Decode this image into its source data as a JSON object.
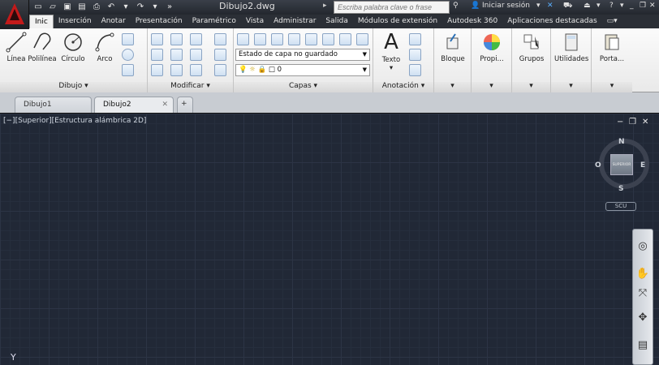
{
  "window": {
    "title": "Dibujo2.dwg",
    "search_placeholder": "Escriba palabra clave o frase",
    "signin": "Iniciar sesión"
  },
  "menu": {
    "tabs": [
      "Inic",
      "Inserción",
      "Anotar",
      "Presentación",
      "Paramétrico",
      "Vista",
      "Administrar",
      "Salida",
      "Módulos de extensión",
      "Autodesk 360",
      "Aplicaciones destacadas"
    ]
  },
  "ribbon": {
    "dibujo": {
      "label": "Dibujo",
      "tools": [
        "Línea",
        "Polilínea",
        "Círculo",
        "Arco"
      ]
    },
    "modificar": {
      "label": "Modificar"
    },
    "capas": {
      "label": "Capas",
      "layer_state": "Estado de capa no guardado",
      "current_layer": "0"
    },
    "anotacion": {
      "label": "Anotación",
      "texto": "Texto"
    },
    "others": [
      "Bloque",
      "Propi...",
      "Grupos",
      "Utilidades",
      "Porta..."
    ]
  },
  "doc_tabs": [
    "Dibujo1",
    "Dibujo2"
  ],
  "viewport": {
    "label": "[−][Superior][Estructura alámbrica 2D]",
    "cube_face": "SUPERIOR",
    "scu": "SCU",
    "n": "N",
    "s": "S",
    "e": "E",
    "o": "O",
    "ucs": "Y"
  },
  "colors": {
    "accent": "#c00000",
    "canvas": "#212836"
  }
}
